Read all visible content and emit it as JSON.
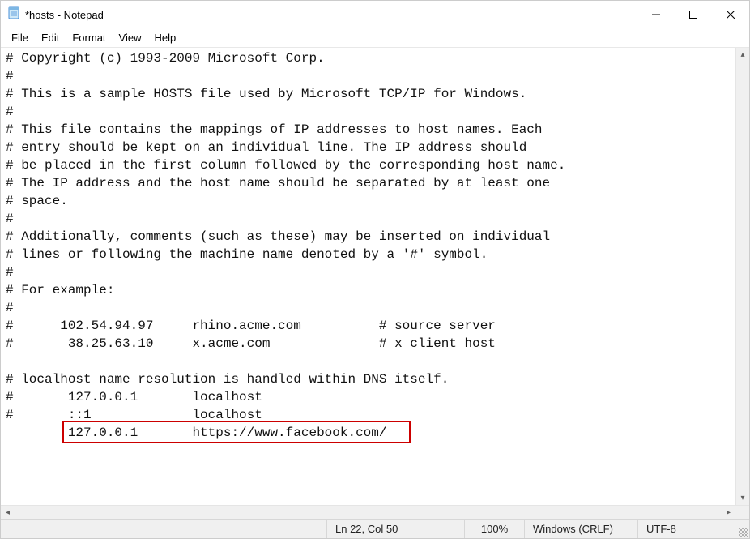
{
  "window": {
    "title": "*hosts - Notepad"
  },
  "menu": {
    "file": "File",
    "edit": "Edit",
    "format": "Format",
    "view": "View",
    "help": "Help"
  },
  "content_lines": [
    "# Copyright (c) 1993-2009 Microsoft Corp.",
    "#",
    "# This is a sample HOSTS file used by Microsoft TCP/IP for Windows.",
    "#",
    "# This file contains the mappings of IP addresses to host names. Each",
    "# entry should be kept on an individual line. The IP address should",
    "# be placed in the first column followed by the corresponding host name.",
    "# The IP address and the host name should be separated by at least one",
    "# space.",
    "#",
    "# Additionally, comments (such as these) may be inserted on individual",
    "# lines or following the machine name denoted by a '#' symbol.",
    "#",
    "# For example:",
    "#",
    "#      102.54.94.97     rhino.acme.com          # source server",
    "#       38.25.63.10     x.acme.com              # x client host",
    "",
    "# localhost name resolution is handled within DNS itself.",
    "#       127.0.0.1       localhost",
    "#       ::1             localhost",
    "        127.0.0.1       https://www.facebook.com/"
  ],
  "status": {
    "position": "Ln 22, Col 50",
    "zoom": "100%",
    "eol": "Windows (CRLF)",
    "encoding": "UTF-8"
  },
  "highlight": {
    "color": "#c00"
  }
}
